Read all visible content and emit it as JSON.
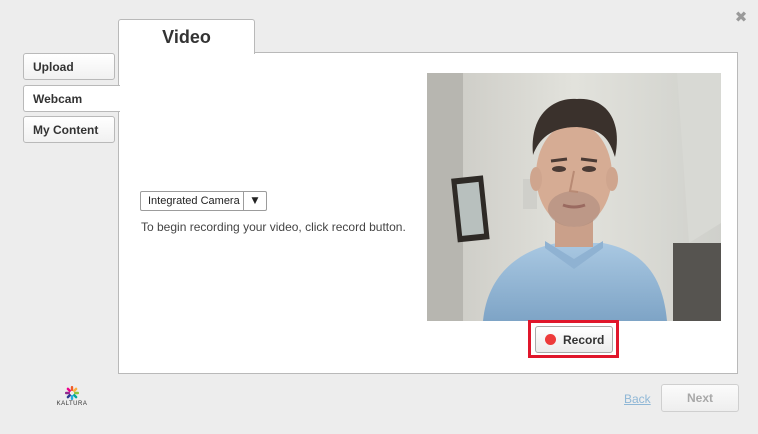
{
  "dialog": {
    "close_symbol": "✖"
  },
  "header": {
    "title": "Video"
  },
  "sidebar": {
    "items": [
      {
        "label": "Upload",
        "active": false
      },
      {
        "label": "Webcam",
        "active": true
      },
      {
        "label": "My Content",
        "active": false
      }
    ]
  },
  "camera": {
    "selected": "Integrated Camera",
    "arrow": "▼"
  },
  "instruction": "To begin recording your video, click record button.",
  "record": {
    "label": "Record"
  },
  "footer": {
    "logo_text": "KALTURA",
    "back_label": "Back",
    "next_label": "Next"
  },
  "colors": {
    "highlight": "#e0162b",
    "record_dot": "#ed3a3a",
    "back_link": "#8fb7d6"
  },
  "icons": {
    "close": "close-icon",
    "record": "record-dot-icon",
    "logo": "kaltura-logo",
    "dropdown": "chevron-down-icon"
  }
}
